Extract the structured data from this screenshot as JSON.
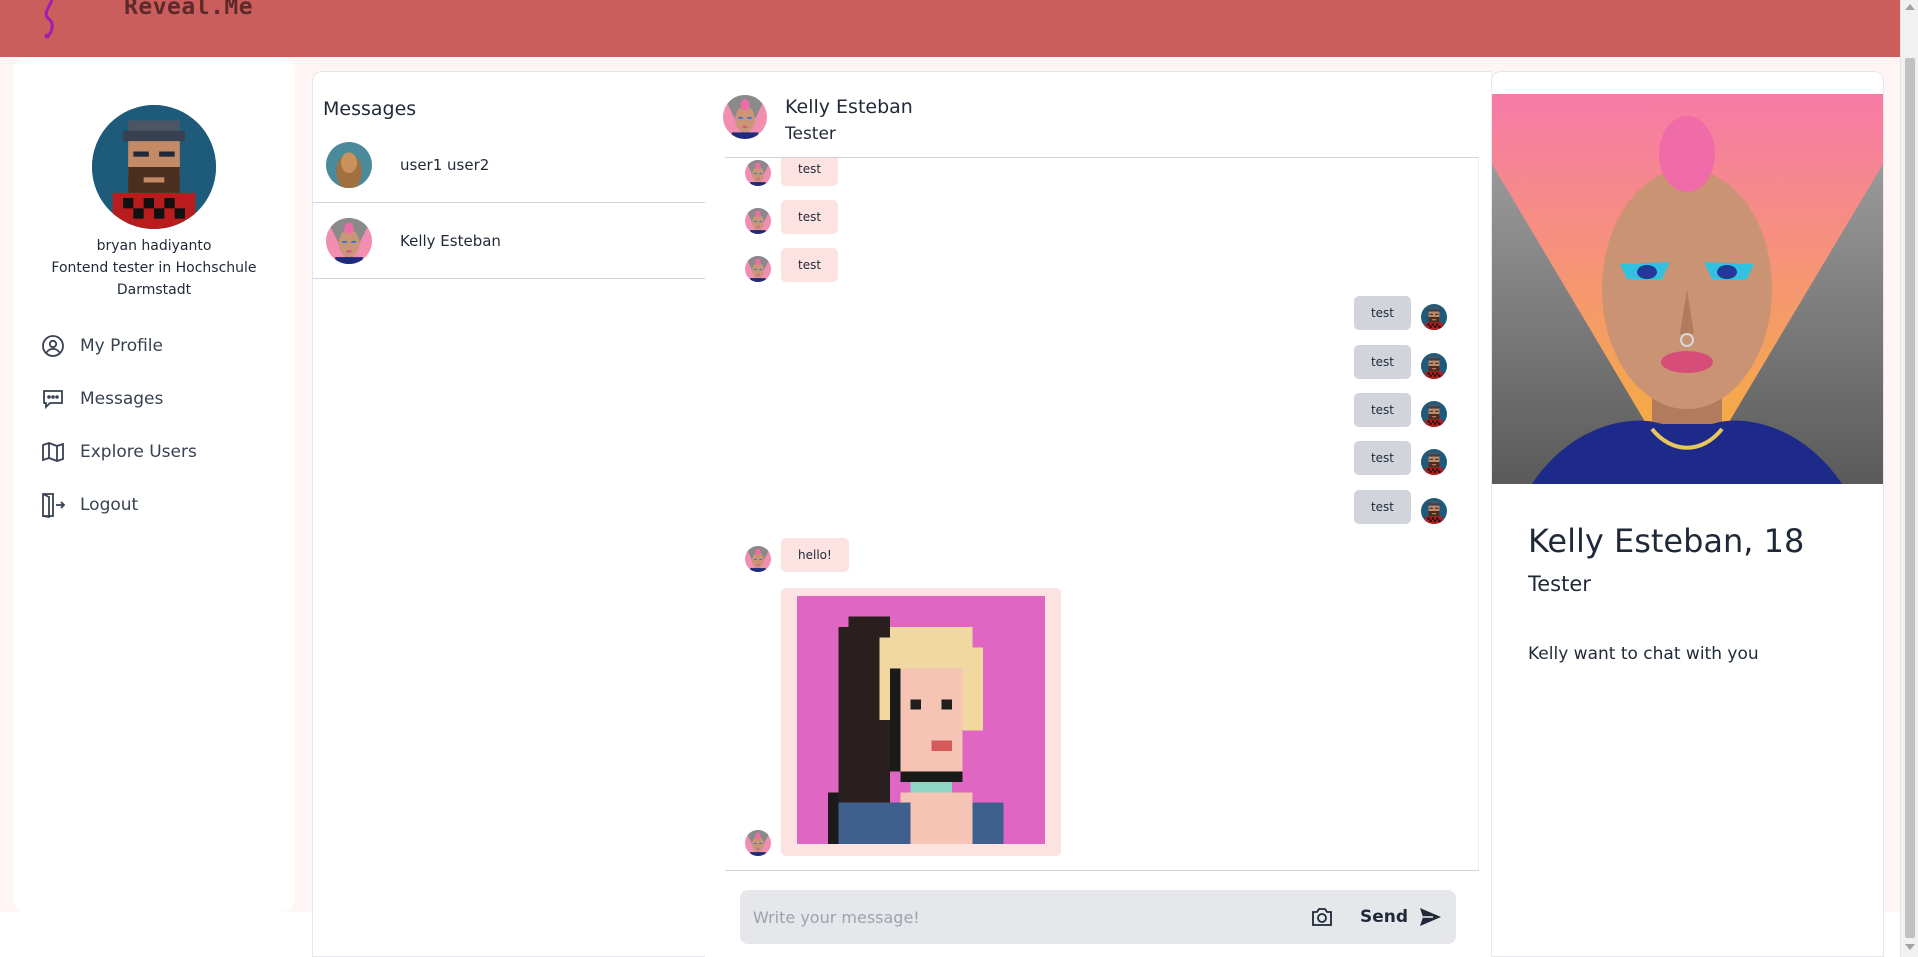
{
  "app": {
    "brand": "Reveal.Me"
  },
  "sidebar": {
    "user_name": "bryan hadiyanto",
    "user_bio": "Fontend tester in Hochschule Darmstadt",
    "items": [
      {
        "label": "My Profile",
        "icon": "user-circle-icon"
      },
      {
        "label": "Messages",
        "icon": "chat-bubble-icon"
      },
      {
        "label": "Explore Users",
        "icon": "map-icon"
      },
      {
        "label": "Logout",
        "icon": "logout-door-icon"
      }
    ]
  },
  "conversations": {
    "title": "Messages",
    "items": [
      {
        "name": "user1 user2"
      },
      {
        "name": "Kelly Esteban"
      }
    ]
  },
  "chat": {
    "contact_name": "Kelly Esteban",
    "contact_subtitle": "Tester",
    "messages": [
      {
        "from": "them",
        "text": "test"
      },
      {
        "from": "them",
        "text": "test"
      },
      {
        "from": "them",
        "text": "test"
      },
      {
        "from": "me",
        "text": "test"
      },
      {
        "from": "me",
        "text": "test"
      },
      {
        "from": "me",
        "text": "test"
      },
      {
        "from": "me",
        "text": "test"
      },
      {
        "from": "me",
        "text": "test"
      },
      {
        "from": "them",
        "text": "hello!"
      },
      {
        "from": "them",
        "type": "image",
        "image": "pixel-art-portrait-image"
      }
    ],
    "composer": {
      "placeholder": "Write your message!",
      "value": "",
      "send_label": "Send"
    }
  },
  "profile_card": {
    "name_age": "Kelly Esteban, 18",
    "role": "Tester",
    "description": "Kelly want to chat with you"
  },
  "colors": {
    "topbar": "#cb5d5d",
    "page_background": "#fff5f5",
    "incoming_bubble": "#fde2e2",
    "outgoing_bubble": "#d1d5db",
    "composer_background": "#e5e7eb"
  }
}
